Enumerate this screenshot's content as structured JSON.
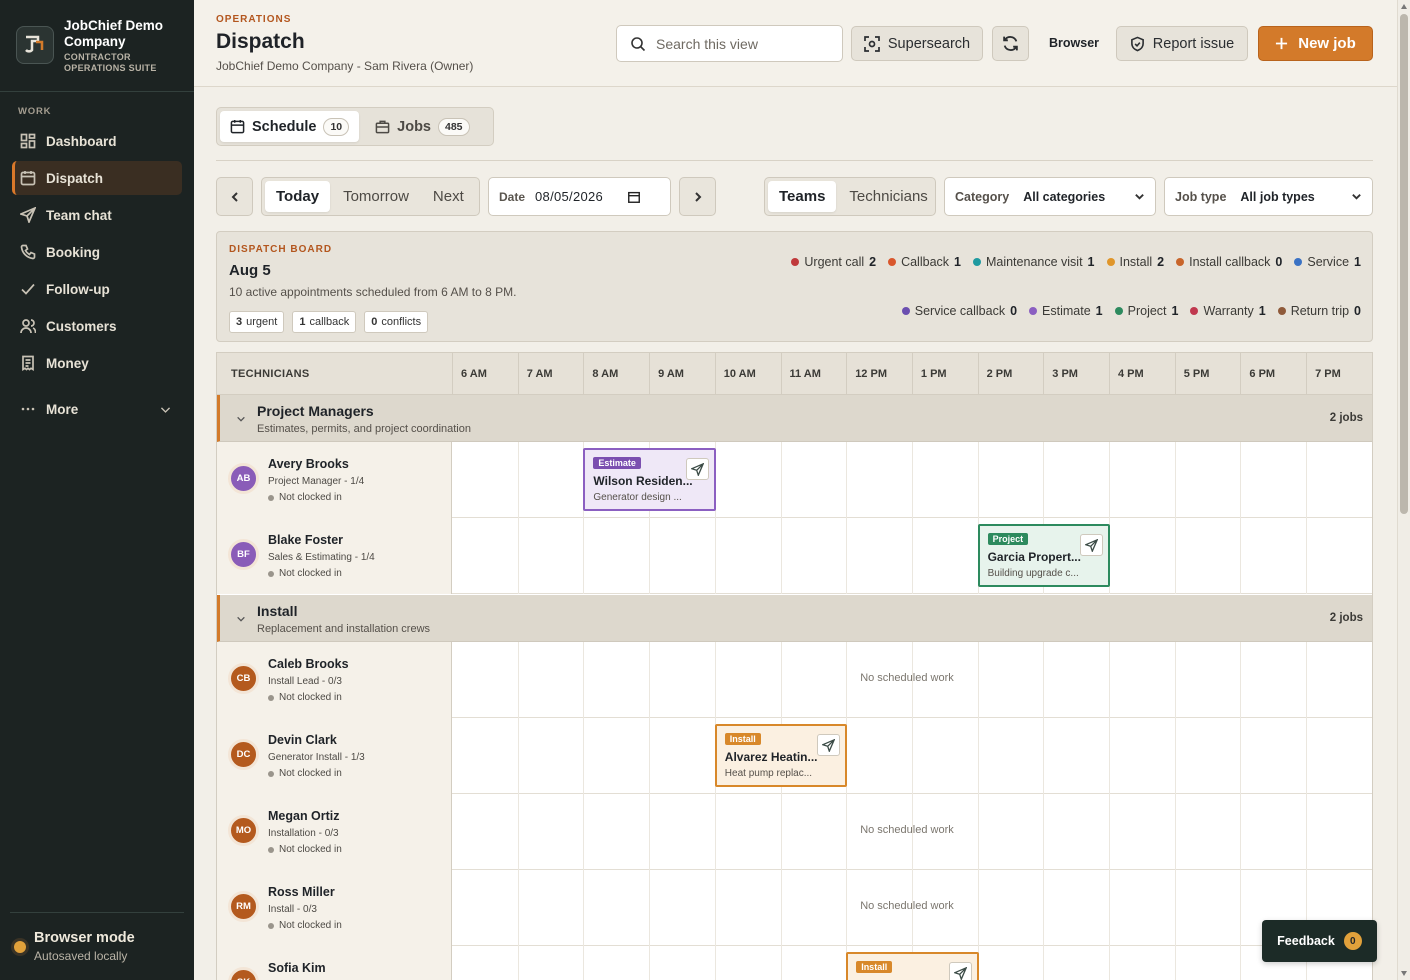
{
  "brand": {
    "name": "JobChief Demo Company",
    "subtitle": "CONTRACTOR OPERATIONS SUITE"
  },
  "sidebar": {
    "section": "WORK",
    "items": [
      {
        "label": "Dashboard",
        "icon": "dashboard-icon"
      },
      {
        "label": "Dispatch",
        "icon": "calendar-icon",
        "active": true
      },
      {
        "label": "Team chat",
        "icon": "send-icon"
      },
      {
        "label": "Booking",
        "icon": "phone-icon"
      },
      {
        "label": "Follow-up",
        "icon": "check-icon"
      },
      {
        "label": "Customers",
        "icon": "users-icon"
      },
      {
        "label": "Money",
        "icon": "receipt-icon"
      }
    ],
    "more_label": "More",
    "footer": {
      "title": "Browser mode",
      "subtitle": "Autosaved locally"
    }
  },
  "header": {
    "eyebrow": "OPERATIONS",
    "title": "Dispatch",
    "subtitle": "JobChief Demo Company - Sam Rivera (Owner)",
    "search_placeholder": "Search this view",
    "supersearch_label": "Supersearch",
    "browser_label": "Browser",
    "report_label": "Report issue",
    "new_job_label": "New job"
  },
  "view_tabs": [
    {
      "label": "Schedule",
      "count": "10",
      "active": true
    },
    {
      "label": "Jobs",
      "count": "485",
      "active": false
    }
  ],
  "toolbar": {
    "day_options": [
      "Today",
      "Tomorrow",
      "Next"
    ],
    "date_label": "Date",
    "date_value": "08/05/2026",
    "group_options": [
      "Teams",
      "Technicians"
    ],
    "category_label": "Category",
    "category_value": "All categories",
    "jobtype_label": "Job type",
    "jobtype_value": "All job types"
  },
  "board": {
    "eyebrow": "DISPATCH BOARD",
    "date": "Aug 5",
    "description": "10 active appointments scheduled from 6 AM to 8 PM.",
    "pills": [
      {
        "count": "3",
        "label": "urgent"
      },
      {
        "count": "1",
        "label": "callback"
      },
      {
        "count": "0",
        "label": "conflicts"
      }
    ],
    "legend_row1": [
      {
        "label": "Urgent call",
        "count": "2",
        "color": "#c0393b"
      },
      {
        "label": "Callback",
        "count": "1",
        "color": "#d9572c"
      },
      {
        "label": "Maintenance visit",
        "count": "1",
        "color": "#1f9aa0"
      },
      {
        "label": "Install",
        "count": "2",
        "color": "#e0962a"
      },
      {
        "label": "Install callback",
        "count": "0",
        "color": "#c8652a"
      },
      {
        "label": "Service",
        "count": "1",
        "color": "#3a72c4"
      }
    ],
    "legend_row2": [
      {
        "label": "Service callback",
        "count": "0",
        "color": "#6b4fb0"
      },
      {
        "label": "Estimate",
        "count": "1",
        "color": "#8b5fc1"
      },
      {
        "label": "Project",
        "count": "1",
        "color": "#2d8a5e"
      },
      {
        "label": "Warranty",
        "count": "1",
        "color": "#c0384e"
      },
      {
        "label": "Return trip",
        "count": "0",
        "color": "#8f5a3a"
      }
    ]
  },
  "grid": {
    "tech_header": "TECHNICIANS",
    "hours": [
      "6 AM",
      "7 AM",
      "8 AM",
      "9 AM",
      "10 AM",
      "11 AM",
      "12 PM",
      "1 PM",
      "2 PM",
      "3 PM",
      "4 PM",
      "5 PM",
      "6 PM",
      "7 PM"
    ],
    "no_work_label": "No scheduled work",
    "teams": [
      {
        "name": "Project Managers",
        "subtitle": "Estimates, permits, and project coordination",
        "jobs": "2 jobs"
      },
      {
        "name": "Install",
        "subtitle": "Replacement and installation crews",
        "jobs": "2 jobs"
      }
    ],
    "techs": [
      {
        "initials": "AB",
        "name": "Avery Brooks",
        "role": "Project Manager - 1/4",
        "status": "Not clocked in",
        "color": "#8a5cb8"
      },
      {
        "initials": "BF",
        "name": "Blake Foster",
        "role": "Sales & Estimating - 1/4",
        "status": "Not clocked in",
        "color": "#8a5cb8"
      },
      {
        "initials": "CB",
        "name": "Caleb Brooks",
        "role": "Install Lead - 0/3",
        "status": "Not clocked in",
        "color": "#b45a1e"
      },
      {
        "initials": "DC",
        "name": "Devin Clark",
        "role": "Generator Install - 1/3",
        "status": "Not clocked in",
        "color": "#b45a1e"
      },
      {
        "initials": "MO",
        "name": "Megan Ortiz",
        "role": "Installation - 0/3",
        "status": "Not clocked in",
        "color": "#b45a1e"
      },
      {
        "initials": "RM",
        "name": "Ross Miller",
        "role": "Install - 0/3",
        "status": "Not clocked in",
        "color": "#b45a1e"
      },
      {
        "initials": "SK",
        "name": "Sofia Kim",
        "role": "",
        "status": "",
        "color": "#b45a1e"
      }
    ],
    "jobs": [
      {
        "tag": "Estimate",
        "title": "Wilson Residen...",
        "desc": "Generator design ...",
        "tag_color": "#7b4fb0",
        "border": "#8b5fc1",
        "bg": "#efe8f7"
      },
      {
        "tag": "Project",
        "title": "Garcia Propert...",
        "desc": "Building upgrade c...",
        "tag_color": "#2d8a5e",
        "border": "#2d8a5e",
        "bg": "#e7f3ec"
      },
      {
        "tag": "Install",
        "title": "Alvarez Heatin...",
        "desc": "Heat pump replac...",
        "tag_color": "#d8882a",
        "border": "#d8882a",
        "bg": "#fbf0e1"
      },
      {
        "tag": "Install",
        "title": "",
        "desc": "",
        "tag_color": "#d8882a",
        "border": "#d8882a",
        "bg": "#fbf0e1"
      }
    ]
  },
  "feedback": {
    "label": "Feedback",
    "count": "0"
  }
}
